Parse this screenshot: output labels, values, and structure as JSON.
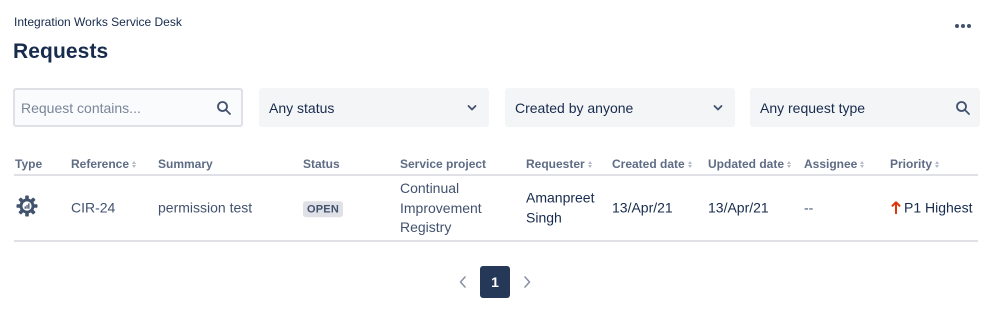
{
  "header": {
    "site_name": "Integration Works Service Desk",
    "page_title": "Requests"
  },
  "filters": {
    "search_placeholder": "Request contains...",
    "status": "Any status",
    "created_by": "Created by anyone",
    "request_type_placeholder": "Any request type"
  },
  "table": {
    "columns": {
      "type": "Type",
      "reference": "Reference",
      "summary": "Summary",
      "status": "Status",
      "service_project": "Service project",
      "requester": "Requester",
      "created_date": "Created date",
      "updated_date": "Updated date",
      "assignee": "Assignee",
      "priority": "Priority"
    },
    "rows": [
      {
        "type_icon": "gear-icon",
        "reference": "CIR-24",
        "summary": "permission test",
        "status": "OPEN",
        "service_project_lines": [
          "Continual",
          "Improvement",
          "Registry"
        ],
        "requester_lines": [
          "Amanpreet",
          "Singh"
        ],
        "created_date": "13/Apr/21",
        "updated_date": "13/Apr/21",
        "assignee": "--",
        "priority": "P1 Highest"
      }
    ]
  },
  "pagination": {
    "current_page": "1"
  },
  "colors": {
    "text_primary": "#172b4d",
    "text_secondary": "#42526e",
    "header_text": "#5e6c84",
    "priority_highest": "#de350b",
    "pager_active": "#253858",
    "filter_bg": "#f4f5f7"
  }
}
